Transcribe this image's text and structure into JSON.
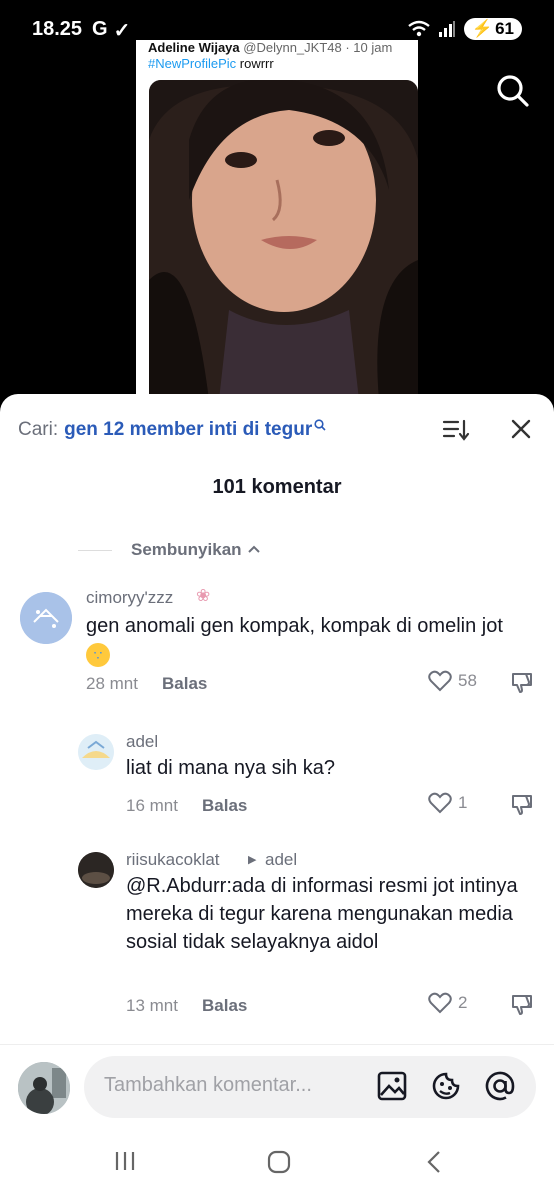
{
  "status": {
    "time": "18.25",
    "battery": "61"
  },
  "tweet": {
    "author": "Adeline Wijaya",
    "handle": "@Delynn_JKT48 · 10 jam",
    "hashtag": "#NewProfilePic",
    "text": "rowrrr"
  },
  "search": {
    "label": "Cari:",
    "query": "gen 12 member inti di tegur"
  },
  "comments_header": {
    "count_label": "101 komentar",
    "hide_label": "Sembunyikan"
  },
  "comments": [
    {
      "name": "cimoryy'zzz",
      "text": "gen anomali gen kompak, kompak di omelin jot",
      "time": "28 mnt",
      "reply": "Balas",
      "likes": "58"
    },
    {
      "name": "adel",
      "text": "liat di mana nya sih ka?",
      "time": "16 mnt",
      "reply": "Balas",
      "likes": "1"
    },
    {
      "name": "riisukacoklat",
      "reply_to": "adel",
      "text": "@R.Abdurr:ada di informasi resmi jot intinya mereka di tegur karena mengunakan media sosial tidak selayaknya aidol",
      "time": "13 mnt",
      "reply": "Balas",
      "likes": "2"
    }
  ],
  "input": {
    "placeholder": "Tambahkan komentar..."
  },
  "icons": [
    "search-icon",
    "sort-icon",
    "close-icon",
    "heart-icon",
    "dislike-icon",
    "image-icon",
    "emoji-icon",
    "mention-icon"
  ],
  "colors": {
    "accent": "#2b5bb8",
    "text": "#161823",
    "muted": "#6b6f7a"
  }
}
